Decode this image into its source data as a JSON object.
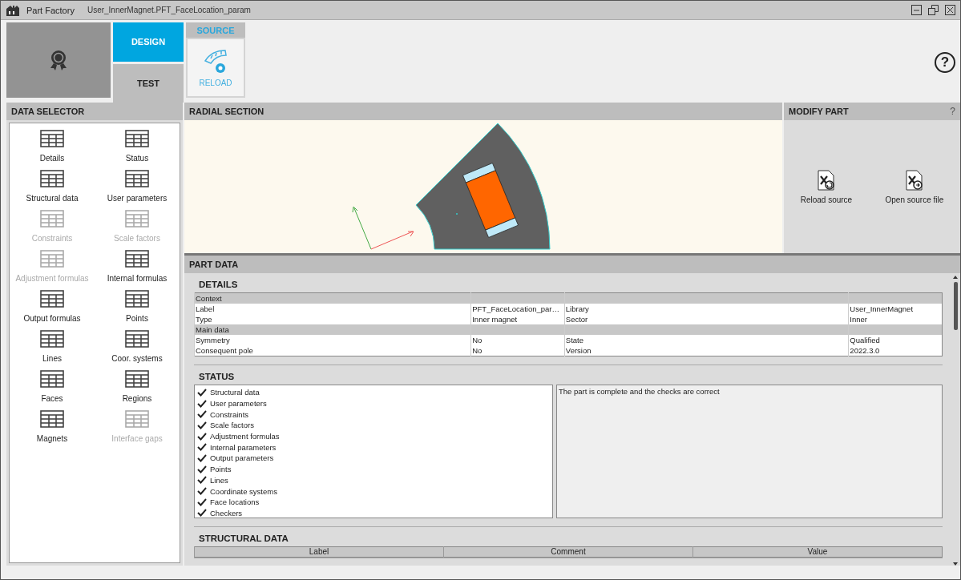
{
  "window": {
    "app_name": "Part Factory",
    "title": "User_InnerMagnet.PFT_FaceLocation_param"
  },
  "modes": [
    {
      "label": "DESIGN",
      "selected": true
    },
    {
      "label": "TEST",
      "selected": false
    }
  ],
  "source": {
    "title": "SOURCE",
    "button": "RELOAD"
  },
  "help": "?",
  "data_selector": {
    "title": "DATA SELECTOR",
    "items": [
      {
        "label": "Details",
        "disabled": false
      },
      {
        "label": "Status",
        "disabled": false
      },
      {
        "label": "Structural data",
        "disabled": false
      },
      {
        "label": "User parameters",
        "disabled": false
      },
      {
        "label": "Constraints",
        "disabled": true
      },
      {
        "label": "Scale factors",
        "disabled": true
      },
      {
        "label": "Adjustment formulas",
        "disabled": true
      },
      {
        "label": "Internal formulas",
        "disabled": false
      },
      {
        "label": "Output formulas",
        "disabled": false
      },
      {
        "label": "Points",
        "disabled": false
      },
      {
        "label": "Lines",
        "disabled": false
      },
      {
        "label": "Coor. systems",
        "disabled": false
      },
      {
        "label": "Faces",
        "disabled": false
      },
      {
        "label": "Regions",
        "disabled": false
      },
      {
        "label": "Magnets",
        "disabled": false
      },
      {
        "label": "Interface gaps",
        "disabled": true
      }
    ]
  },
  "radial_section": {
    "title": "RADIAL SECTION"
  },
  "modify_part": {
    "title": "MODIFY PART",
    "help": "?",
    "actions": [
      "Reload source",
      "Open source file"
    ]
  },
  "part_data": {
    "title": "PART DATA",
    "details": {
      "title": "DETAILS",
      "rows": [
        {
          "kind": "group",
          "cells": [
            "Context"
          ]
        },
        {
          "kind": "data",
          "cells": [
            "Label",
            "PFT_FaceLocation_par…",
            "Library",
            "User_InnerMagnet"
          ]
        },
        {
          "kind": "data",
          "cells": [
            "Type",
            "Inner magnet",
            "Sector",
            "Inner"
          ]
        },
        {
          "kind": "group",
          "cells": [
            "Main data"
          ]
        },
        {
          "kind": "data",
          "cells": [
            "Symmetry",
            "No",
            "State",
            "Qualified"
          ]
        },
        {
          "kind": "data",
          "cells": [
            "Consequent pole",
            "No",
            "Version",
            "2022.3.0"
          ]
        }
      ]
    },
    "status": {
      "title": "STATUS",
      "message": "The part is complete and the checks are correct",
      "items": [
        {
          "label": "Structural data",
          "checked": true
        },
        {
          "label": "User parameters",
          "checked": true
        },
        {
          "label": "Constraints",
          "checked": true
        },
        {
          "label": "Scale factors",
          "checked": true
        },
        {
          "label": "Adjustment formulas",
          "checked": true
        },
        {
          "label": "Internal parameters",
          "checked": true
        },
        {
          "label": "Output parameters",
          "checked": true
        },
        {
          "label": "Points",
          "checked": true
        },
        {
          "label": "Lines",
          "checked": true
        },
        {
          "label": "Coordinate systems",
          "checked": true
        },
        {
          "label": "Face locations",
          "checked": true
        },
        {
          "label": "Checkers",
          "checked": true
        }
      ]
    },
    "structural_data": {
      "title": "STRUCTURAL DATA",
      "columns": [
        "Label",
        "Comment",
        "Value"
      ]
    }
  }
}
